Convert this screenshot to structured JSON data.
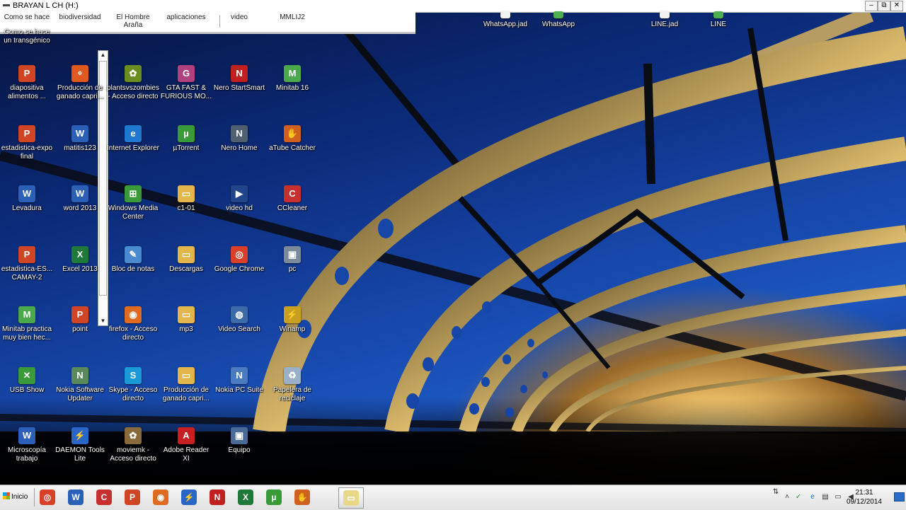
{
  "window": {
    "title": "BRAYAN L CH (H:)",
    "controls": [
      "–",
      "⧉",
      "✕"
    ],
    "partial_items": [
      "Como se hace",
      "biodiversidad",
      "El Hombre Araña",
      "aplicaciones",
      "video",
      "MMLIJ2"
    ]
  },
  "desktop": {
    "top_row": [
      {
        "label": "Como se hace un transgénico",
        "color": "#1c5aa8"
      },
      {
        "label": "WhatsApp.jad",
        "color": "#f2f2f2"
      },
      {
        "label": "WhatsApp",
        "color": "#4caf50"
      },
      {
        "label": "LINE.jad",
        "color": "#f2f2f2"
      },
      {
        "label": "LINE",
        "color": "#4caf50"
      }
    ],
    "icons": [
      {
        "label": "diapositiva alimentos ...",
        "color": "#d04525",
        "sym": "P"
      },
      {
        "label": "Producción de ganado capri...",
        "color": "#e05a20",
        "sym": "⚬"
      },
      {
        "label": "plantsvszombies - Acceso directo",
        "color": "#6b8e23",
        "sym": "✿"
      },
      {
        "label": "GTA FAST & FURIOUS MO...",
        "color": "#b04080",
        "sym": "G"
      },
      {
        "label": "Nero StartSmart",
        "color": "#c02020",
        "sym": "N"
      },
      {
        "label": "Minitab 16",
        "color": "#4ca84c",
        "sym": "M"
      },
      {
        "label": "estadistica-expo final",
        "color": "#d04525",
        "sym": "P"
      },
      {
        "label": "matitis123",
        "color": "#2b5fb8",
        "sym": "W"
      },
      {
        "label": "Internet Explorer",
        "color": "#1e78d0",
        "sym": "e"
      },
      {
        "label": "µTorrent",
        "color": "#3a9a3a",
        "sym": "µ"
      },
      {
        "label": "Nero Home",
        "color": "#506070",
        "sym": "N"
      },
      {
        "label": "aTube Catcher",
        "color": "#d06020",
        "sym": "✋"
      },
      {
        "label": "Levadura",
        "color": "#2b5fb8",
        "sym": "W"
      },
      {
        "label": "word 2013",
        "color": "#2b5fb8",
        "sym": "W"
      },
      {
        "label": "Windows Media Center",
        "color": "#3a9a3a",
        "sym": "⊞"
      },
      {
        "label": "c1-01",
        "color": "#e2b64a",
        "sym": "▭"
      },
      {
        "label": "video hd",
        "color": "#224488",
        "sym": "▶"
      },
      {
        "label": "CCleaner",
        "color": "#c83030",
        "sym": "C"
      },
      {
        "label": "estadistica-ES... CAMAY-2",
        "color": "#d04525",
        "sym": "P"
      },
      {
        "label": "Excel 2013",
        "color": "#1f7a3a",
        "sym": "X"
      },
      {
        "label": "Bloc de notas",
        "color": "#4a8ad0",
        "sym": "✎"
      },
      {
        "label": "Descargas",
        "color": "#e2b64a",
        "sym": "▭"
      },
      {
        "label": "Google Chrome",
        "color": "#d8402a",
        "sym": "◎"
      },
      {
        "label": "pc",
        "color": "#7a8a9a",
        "sym": "▣"
      },
      {
        "label": "Minitab practica muy bien hec...",
        "color": "#4ca84c",
        "sym": "M"
      },
      {
        "label": "point",
        "color": "#d04525",
        "sym": "P"
      },
      {
        "label": "firefox - Acceso directo",
        "color": "#e06a20",
        "sym": "◉"
      },
      {
        "label": "mp3",
        "color": "#e2b64a",
        "sym": "▭"
      },
      {
        "label": "Video Search",
        "color": "#3a6aa8",
        "sym": "◍"
      },
      {
        "label": "Winamp",
        "color": "#c8a020",
        "sym": "⚡"
      },
      {
        "label": "USB Show",
        "color": "#3a9a3a",
        "sym": "✕"
      },
      {
        "label": "Nokia Software Updater",
        "color": "#5a8a5a",
        "sym": "N"
      },
      {
        "label": "Skype - Acceso directo",
        "color": "#1a9ad6",
        "sym": "S"
      },
      {
        "label": "Producción de ganado capri...",
        "color": "#e2b64a",
        "sym": "▭"
      },
      {
        "label": "Nokia PC Suite",
        "color": "#4a7ac0",
        "sym": "N"
      },
      {
        "label": "Papelera de reciclaje",
        "color": "#9ab0c8",
        "sym": "♻"
      },
      {
        "label": "Microscopía trabajo",
        "color": "#2b5fb8",
        "sym": "W"
      },
      {
        "label": "DAEMON Tools Lite",
        "color": "#2a66c8",
        "sym": "⚡"
      },
      {
        "label": "moviemk - Acceso directo",
        "color": "#8a6a3a",
        "sym": "✿"
      },
      {
        "label": "Adobe Reader XI",
        "color": "#c82020",
        "sym": "A"
      },
      {
        "label": "Equipo",
        "color": "#4a6a9a",
        "sym": "▣"
      }
    ]
  },
  "taskbar": {
    "start_label": "Inicio",
    "pinned": [
      {
        "name": "chrome-taskbar-icon",
        "color": "#d8402a",
        "sym": "◎"
      },
      {
        "name": "word-taskbar-icon",
        "color": "#2b5fb8",
        "sym": "W"
      },
      {
        "name": "ccleaner-taskbar-icon",
        "color": "#c83030",
        "sym": "C"
      },
      {
        "name": "powerpoint-taskbar-icon",
        "color": "#d04525",
        "sym": "P"
      },
      {
        "name": "firefox-taskbar-icon",
        "color": "#e06a20",
        "sym": "◉"
      },
      {
        "name": "daemon-tools-taskbar-icon",
        "color": "#2a66c8",
        "sym": "⚡"
      },
      {
        "name": "nero-taskbar-icon",
        "color": "#c02020",
        "sym": "N"
      },
      {
        "name": "excel-taskbar-icon",
        "color": "#1f7a3a",
        "sym": "X"
      },
      {
        "name": "utorrent-taskbar-icon",
        "color": "#3a9a3a",
        "sym": "µ"
      },
      {
        "name": "atube-catcher-taskbar-icon",
        "color": "#d06020",
        "sym": "✋"
      },
      {
        "name": "explorer-window-taskbar-button",
        "color": "#e8d88a",
        "sym": "▭"
      }
    ],
    "clock": {
      "time": "21:31",
      "date": "09/12/2014"
    }
  }
}
